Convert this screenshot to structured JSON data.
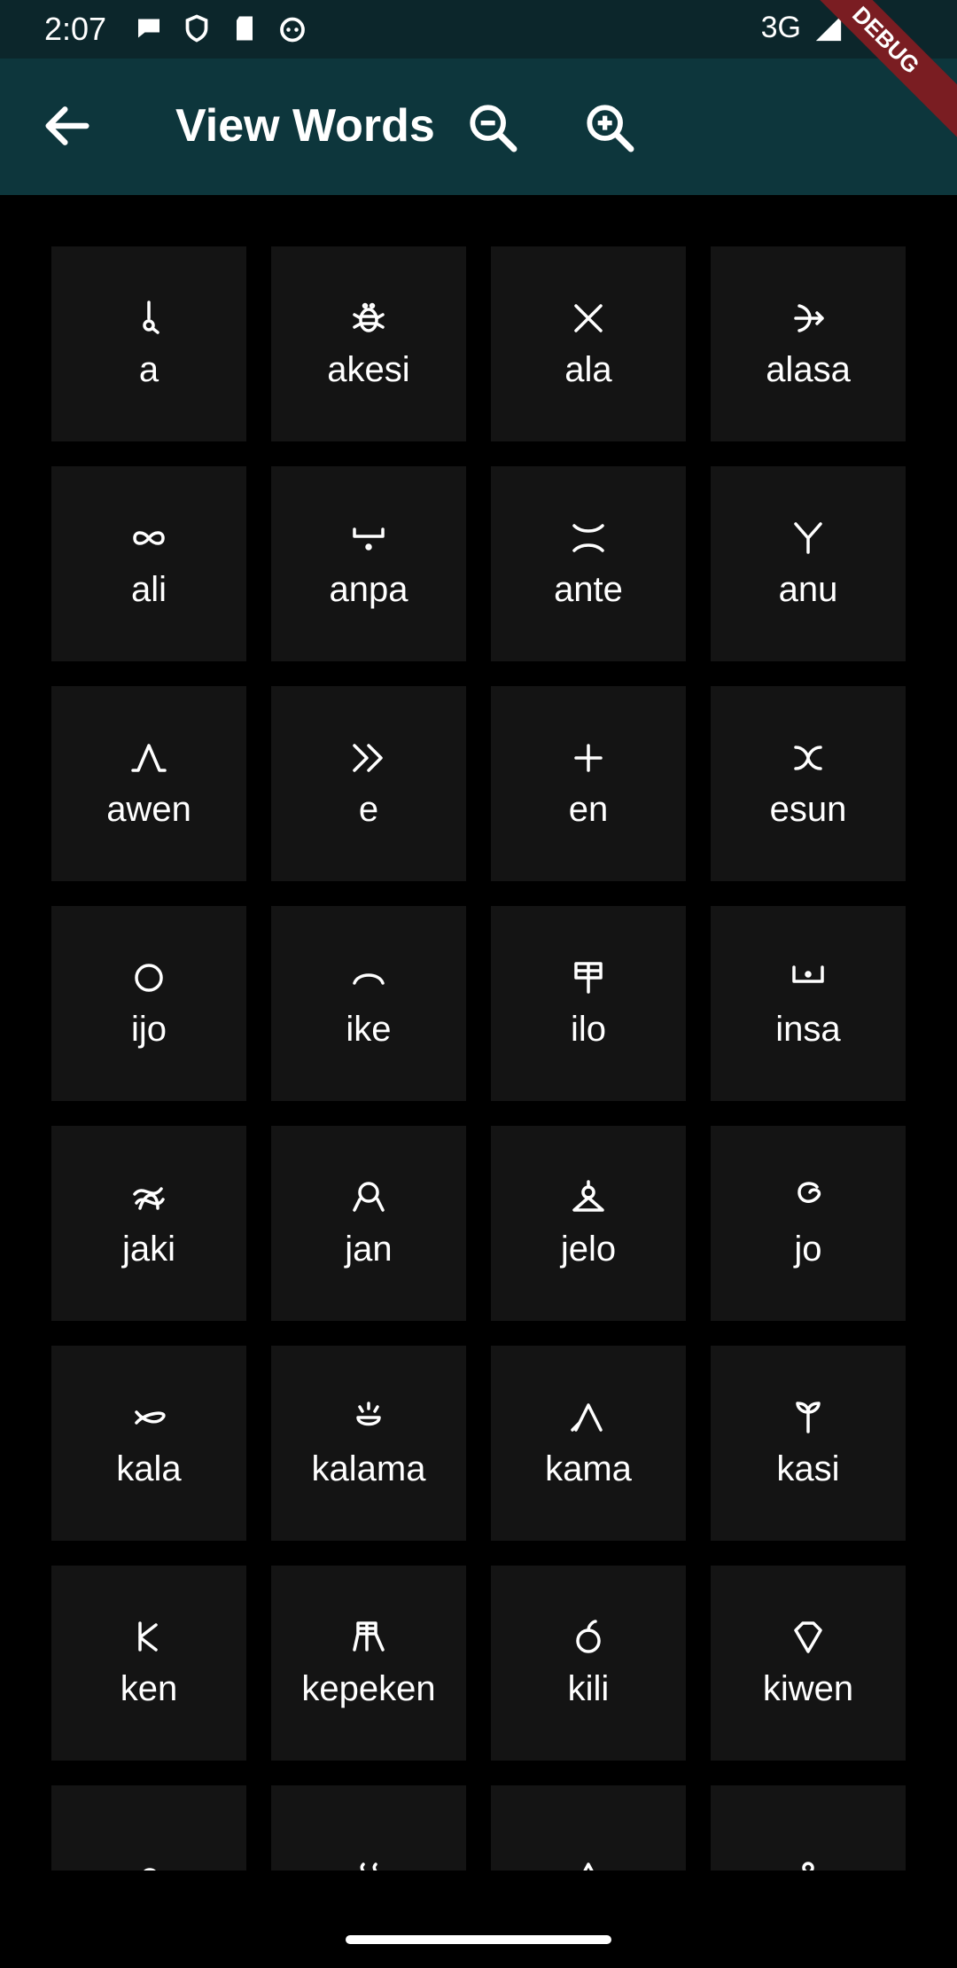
{
  "status": {
    "time": "2:07",
    "network": "3G",
    "left_icons": [
      "chat-bubble-icon",
      "shield-icon",
      "sd-card-icon",
      "android-face-icon"
    ],
    "right_icons": [
      "signal-icon",
      "battery-icon"
    ]
  },
  "appbar": {
    "title": "View Words",
    "back_icon": "arrow-left-icon",
    "zoom_out_icon": "zoom-out-icon",
    "zoom_in_icon": "zoom-in-icon",
    "background": "#0d363c"
  },
  "debug_banner": "DEBUG",
  "words": [
    {
      "word": "a",
      "glyph": "a"
    },
    {
      "word": "akesi",
      "glyph": "akesi"
    },
    {
      "word": "ala",
      "glyph": "ala"
    },
    {
      "word": "alasa",
      "glyph": "alasa"
    },
    {
      "word": "ali",
      "glyph": "ali"
    },
    {
      "word": "anpa",
      "glyph": "anpa"
    },
    {
      "word": "ante",
      "glyph": "ante"
    },
    {
      "word": "anu",
      "glyph": "anu"
    },
    {
      "word": "awen",
      "glyph": "awen"
    },
    {
      "word": "e",
      "glyph": "e"
    },
    {
      "word": "en",
      "glyph": "en"
    },
    {
      "word": "esun",
      "glyph": "esun"
    },
    {
      "word": "ijo",
      "glyph": "ijo"
    },
    {
      "word": "ike",
      "glyph": "ike"
    },
    {
      "word": "ilo",
      "glyph": "ilo"
    },
    {
      "word": "insa",
      "glyph": "insa"
    },
    {
      "word": "jaki",
      "glyph": "jaki"
    },
    {
      "word": "jan",
      "glyph": "jan"
    },
    {
      "word": "jelo",
      "glyph": "jelo"
    },
    {
      "word": "jo",
      "glyph": "jo"
    },
    {
      "word": "kala",
      "glyph": "kala"
    },
    {
      "word": "kalama",
      "glyph": "kalama"
    },
    {
      "word": "kama",
      "glyph": "kama"
    },
    {
      "word": "kasi",
      "glyph": "kasi"
    },
    {
      "word": "ken",
      "glyph": "ken"
    },
    {
      "word": "kepeken",
      "glyph": "kepeken"
    },
    {
      "word": "kili",
      "glyph": "kili"
    },
    {
      "word": "kiwen",
      "glyph": "kiwen"
    },
    {
      "word": "",
      "glyph": "ko"
    },
    {
      "word": "",
      "glyph": "kon"
    },
    {
      "word": "",
      "glyph": "kule"
    },
    {
      "word": "",
      "glyph": "kulupu"
    }
  ]
}
